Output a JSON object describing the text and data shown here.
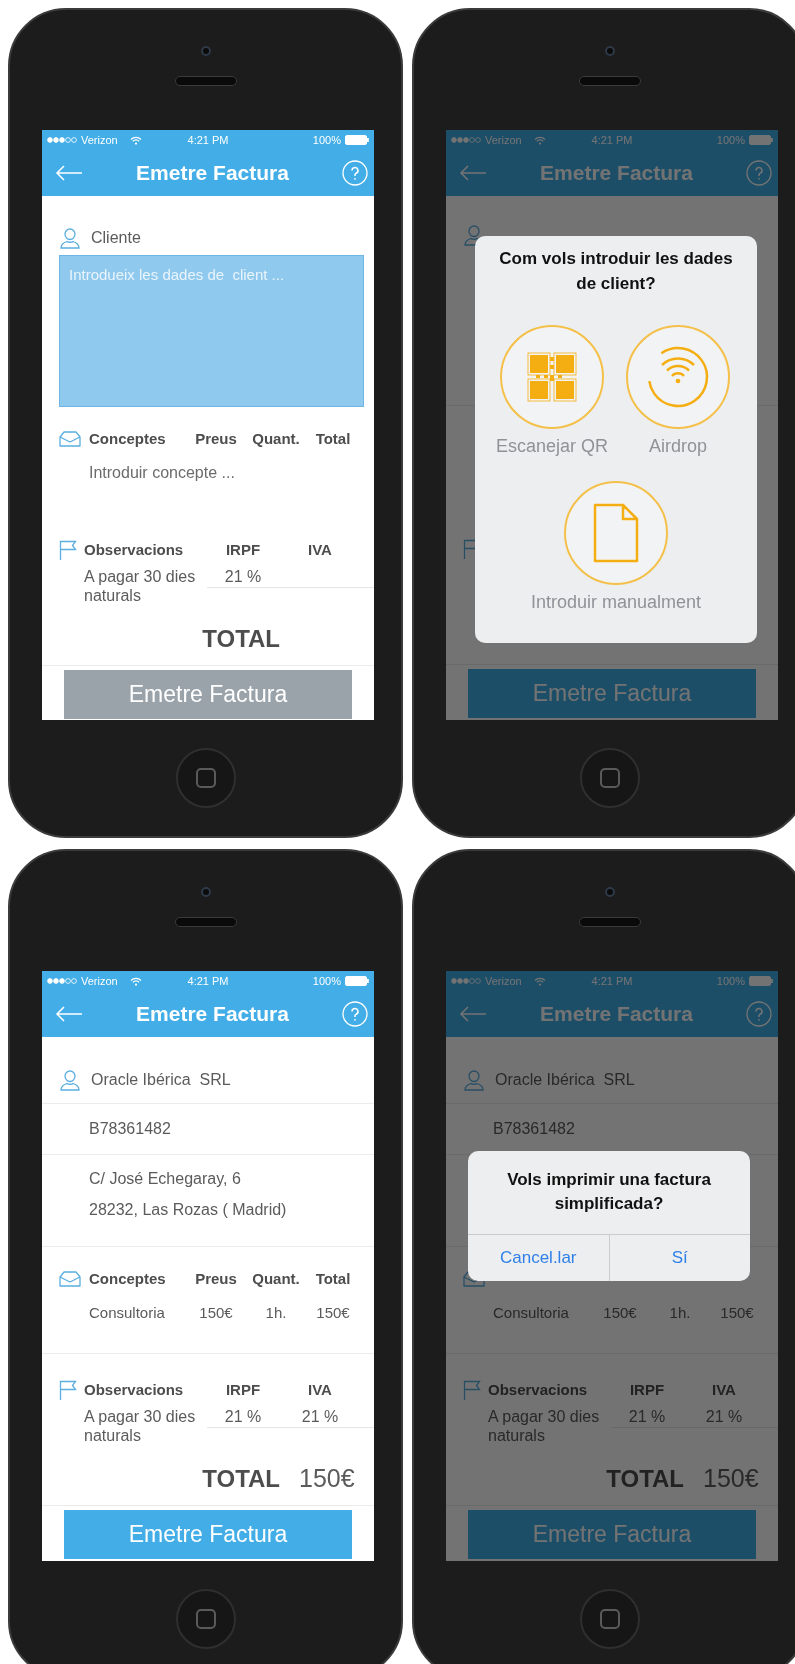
{
  "screens": [
    {
      "status_bar": {
        "carrier": "Verizon",
        "time": "4:21 PM",
        "battery": "100%"
      },
      "header": {
        "title": "Emetre Factura"
      },
      "dimmed": false,
      "client": {
        "kind": "entry",
        "label": "Cliente",
        "placeholder": "Introdueix les dades de  client ..."
      },
      "concepts": {
        "columns": [
          "Conceptes",
          "Preus",
          "Quant.",
          "Total"
        ],
        "placeholder": "Introduir concepte ..."
      },
      "observations": {
        "columns": [
          "Observacions",
          "IRPF",
          "IVA"
        ],
        "note": "A pagar 30 dies naturals",
        "irpf": "21 %"
      },
      "total": {
        "label": "TOTAL"
      },
      "button": {
        "label": "Emetre Factura",
        "disabled": true
      }
    },
    {
      "status_bar": {
        "carrier": "Verizon",
        "time": "4:21 PM",
        "battery": "100%"
      },
      "header": {
        "title": "Emetre Factura"
      },
      "dimmed": true,
      "client": {
        "kind": "covered"
      },
      "button": {
        "label": "Emetre Factura",
        "disabled": false
      },
      "dialog": {
        "kind": "choice",
        "title": "Com vols introduir les dades de client?",
        "options": [
          {
            "kind": "qr",
            "label": "Escanejar QR"
          },
          {
            "kind": "wireless",
            "label": "Airdrop"
          },
          {
            "kind": "document",
            "label": "Introduir manualment"
          }
        ]
      }
    },
    {
      "status_bar": {
        "carrier": "Verizon",
        "time": "4:21 PM",
        "battery": "100%"
      },
      "header": {
        "title": "Emetre Factura"
      },
      "dimmed": false,
      "client": {
        "kind": "filled",
        "name": "Oracle Ibérica  SRL",
        "tax_id": "B78361482",
        "address": [
          "C/ José Echegaray, 6",
          "28232, Las Rozas ( Madrid)"
        ]
      },
      "concepts": {
        "columns": [
          "Conceptes",
          "Preus",
          "Quant.",
          "Total"
        ],
        "rows": [
          {
            "cells": [
              "Consultoria",
              "150€",
              "1h.",
              "150€"
            ]
          }
        ]
      },
      "observations": {
        "columns": [
          "Observacions",
          "IRPF",
          "IVA"
        ],
        "note": "A pagar 30 dies naturals",
        "irpf": "21 %",
        "iva": "21 %"
      },
      "total": {
        "label": "TOTAL",
        "value": "150€"
      },
      "button": {
        "label": "Emetre Factura",
        "disabled": false
      }
    },
    {
      "status_bar": {
        "carrier": "Verizon",
        "time": "4:21 PM",
        "battery": "100%"
      },
      "header": {
        "title": "Emetre Factura"
      },
      "dimmed": true,
      "client": {
        "kind": "filled",
        "name": "Oracle Ibérica  SRL",
        "tax_id": "B78361482"
      },
      "concepts": {
        "rows": [
          {
            "cells": [
              "Consultoria",
              "150€",
              "1h.",
              "150€"
            ]
          }
        ]
      },
      "observations": {
        "columns": [
          "Observacions",
          "IRPF",
          "IVA"
        ],
        "note": "A pagar 30 dies naturals",
        "irpf": "21 %",
        "iva": "21 %"
      },
      "total": {
        "label": "TOTAL",
        "value": "150€"
      },
      "button": {
        "label": "Emetre Factura",
        "disabled": false
      },
      "dialog": {
        "kind": "confirm",
        "title": "Vols imprimir una factura simplificada?",
        "buttons": [
          "Cancel.lar",
          "Sí"
        ]
      }
    }
  ]
}
